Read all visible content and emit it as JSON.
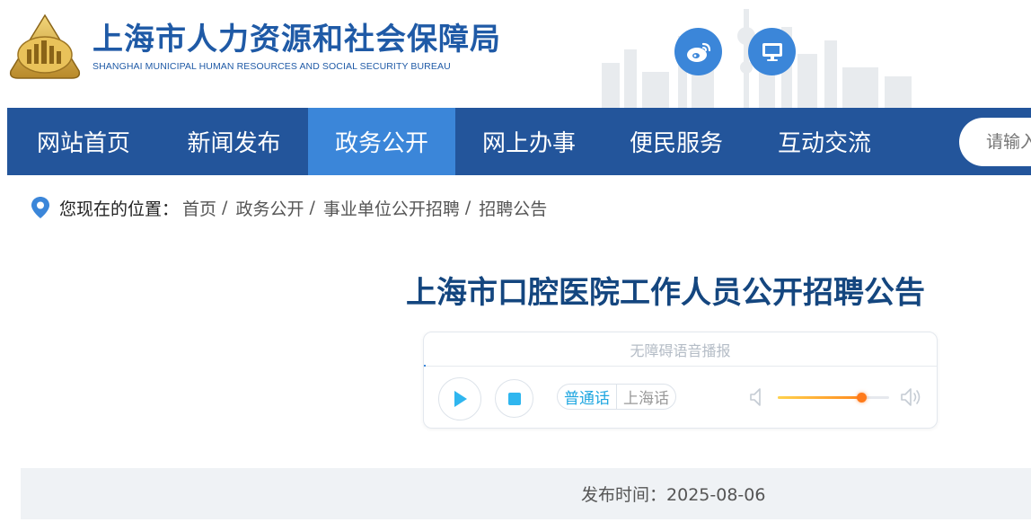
{
  "header": {
    "title": "上海市人力资源和社会保障局",
    "subtitle": "SHANGHAI MUNICIPAL HUMAN RESOURCES AND SOCIAL SECURITY BUREAU",
    "icons": [
      "logo-emblem",
      "weibo-icon",
      "desktop-icon"
    ]
  },
  "nav": {
    "items": [
      {
        "label": "网站首页"
      },
      {
        "label": "新闻发布"
      },
      {
        "label": "政务公开",
        "active": true
      },
      {
        "label": "网上办事"
      },
      {
        "label": "便民服务"
      },
      {
        "label": "互动交流"
      }
    ],
    "search_placeholder": "请输入"
  },
  "breadcrumb": {
    "label": "您现在的位置：",
    "items": [
      "首页",
      "政务公开",
      "事业单位公开招聘",
      "招聘公告"
    ],
    "separator": "/"
  },
  "article": {
    "title": "上海市口腔医院工作人员公开招聘公告",
    "publish_date_label": "发布时间：",
    "publish_date": "2025-08-06"
  },
  "player": {
    "title": "无障碍语音播报",
    "lang_options": [
      "普通话",
      "上海话"
    ],
    "selected_lang": "普通话",
    "volume": 0.75,
    "progress": 0.0
  },
  "colors": {
    "nav_bg": "#23559b",
    "nav_active": "#3b86d9",
    "title_blue": "#14467f",
    "accent_cyan": "#1ea6e0",
    "volume_orange": "#ff7a1a"
  }
}
